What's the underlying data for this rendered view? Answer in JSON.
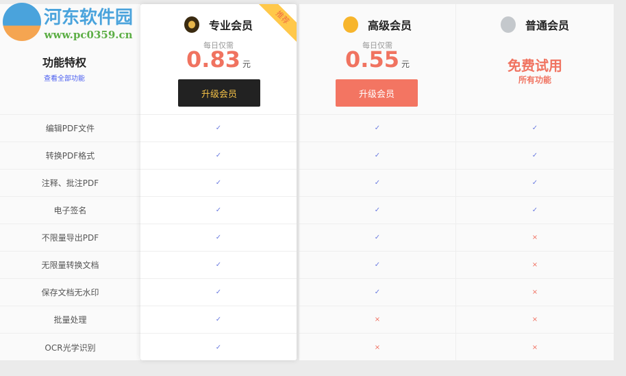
{
  "watermark": {
    "name": "河东软件园",
    "url": "www.pc0359.cn"
  },
  "features_header": {
    "title": "功能特权",
    "link": "查看全部功能"
  },
  "features": [
    "编辑PDF文件",
    "转换PDF格式",
    "注释、批注PDF",
    "电子签名",
    "不限量导出PDF",
    "无限量转换文档",
    "保存文档无水印",
    "批量处理",
    "OCR光学识别"
  ],
  "plans": [
    {
      "name": "专业会员",
      "badge": "推荐",
      "price_label": "每日仅需",
      "price": "0.83",
      "unit": "元",
      "button": "升级会员",
      "medal_color": "#3a2a10",
      "support": [
        true,
        true,
        true,
        true,
        true,
        true,
        true,
        true,
        true
      ]
    },
    {
      "name": "高级会员",
      "price_label": "每日仅需",
      "price": "0.55",
      "unit": "元",
      "button": "升级会员",
      "medal_color": "#f7b52c",
      "support": [
        true,
        true,
        true,
        true,
        true,
        true,
        true,
        false,
        false
      ]
    },
    {
      "name": "普通会员",
      "free_title": "免费试用",
      "free_sub": "所有功能",
      "medal_color": "#c4c8cc",
      "support": [
        true,
        true,
        true,
        true,
        false,
        false,
        false,
        false,
        false
      ]
    }
  ],
  "marks": {
    "yes": "✓",
    "no": "×"
  }
}
